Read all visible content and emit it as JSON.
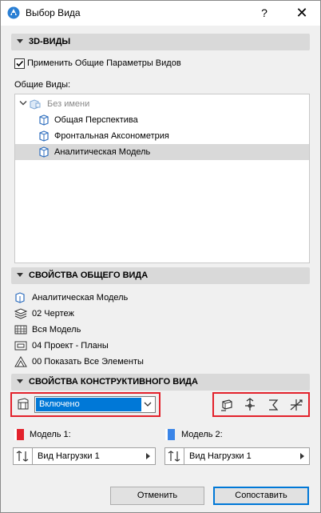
{
  "window": {
    "title": "Выбор Вида",
    "help_label": "?",
    "close_label": "✕"
  },
  "section_3d": {
    "title": "3D-ВИДЫ"
  },
  "apply_checkbox": {
    "label": "Применить Общие Параметры Видов",
    "checked": true
  },
  "general_views_label": "Общие Виды:",
  "tree": {
    "root": {
      "label": "Без имени",
      "icon": "folder-views-icon"
    },
    "items": [
      {
        "label": "Общая Перспектива",
        "icon": "3d-view-icon",
        "selected": false
      },
      {
        "label": "Фронтальная Аксонометрия",
        "icon": "3d-view-icon",
        "selected": false
      },
      {
        "label": "Аналитическая Модель",
        "icon": "3d-view-icon",
        "selected": true
      }
    ]
  },
  "section_general_props": {
    "title": "СВОЙСТВА ОБЩЕГО ВИДА"
  },
  "general_props": [
    {
      "icon": "view-icon",
      "label": "Аналитическая Модель"
    },
    {
      "icon": "layers-icon",
      "label": "02 Чертеж"
    },
    {
      "icon": "model-view-icon",
      "label": "Вся Модель"
    },
    {
      "icon": "plan-icon",
      "label": "04 Проект - Планы"
    },
    {
      "icon": "renovation-icon",
      "label": "00 Показать Все Элементы"
    }
  ],
  "section_structural": {
    "title": "СВОЙСТВА КОНСТРУКТИВНОГО ВИДА"
  },
  "structural": {
    "dropdown_value": "Включено",
    "icon_buttons": [
      "structural-icon-1",
      "structural-icon-2",
      "structural-icon-3",
      "structural-icon-4"
    ]
  },
  "model1": {
    "label": "Модель 1:",
    "color": "#e3222c",
    "combo_value": "Вид Нагрузки 1"
  },
  "model2": {
    "label": "Модель 2:",
    "color": "#3a85e8",
    "combo_value": "Вид Нагрузки 1"
  },
  "buttons": {
    "cancel": "Отменить",
    "compare": "Сопоставить"
  },
  "colors": {
    "selection": "#0078d7",
    "highlight_border": "#e3222c",
    "section_bg": "#d9d9d9"
  }
}
